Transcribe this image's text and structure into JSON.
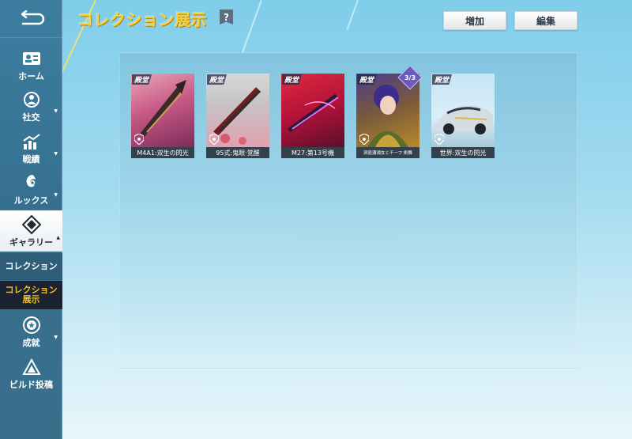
{
  "header": {
    "title": "コレクション展示",
    "help_symbol": "?",
    "add_label": "増加",
    "edit_label": "編集"
  },
  "sidebar": {
    "back_icon": "back-arrow-icon",
    "items": [
      {
        "label": "ホーム",
        "icon": "id-card-icon",
        "expandable": false
      },
      {
        "label": "社交",
        "icon": "social-icon",
        "expandable": true
      },
      {
        "label": "戦績",
        "icon": "chart-icon",
        "expandable": true
      },
      {
        "label": "ルックス",
        "icon": "dragon-icon",
        "expandable": true
      },
      {
        "label": "ギャラリー",
        "icon": "gallery-icon",
        "expandable": true,
        "active": true
      },
      {
        "label": "成就",
        "icon": "medal-icon",
        "expandable": true
      },
      {
        "label": "ビルド投稿",
        "icon": "build-icon",
        "expandable": false
      }
    ],
    "sub_items": [
      {
        "label": "コレクション",
        "selected": false
      },
      {
        "label": "コレクション\n展示",
        "selected": true
      }
    ]
  },
  "cards": [
    {
      "name": "M4A1:双生の閃光",
      "tag": "殿堂"
    },
    {
      "name": "95式:鬼眼·覚醒",
      "tag": "殿堂"
    },
    {
      "name": "M27:第13号機",
      "tag": "殿堂"
    },
    {
      "name": "洞庭瀟湘女とチーフ·剣舞",
      "tag": "殿堂",
      "count": "3/3"
    },
    {
      "name": "世界:双生の閃光",
      "tag": "殿堂"
    }
  ],
  "colors": {
    "accent_yellow": "#f5d23a",
    "selected_bg": "#1b2230",
    "selected_text": "#f2c21b",
    "sidebar_bg": "#3d7ea0"
  }
}
